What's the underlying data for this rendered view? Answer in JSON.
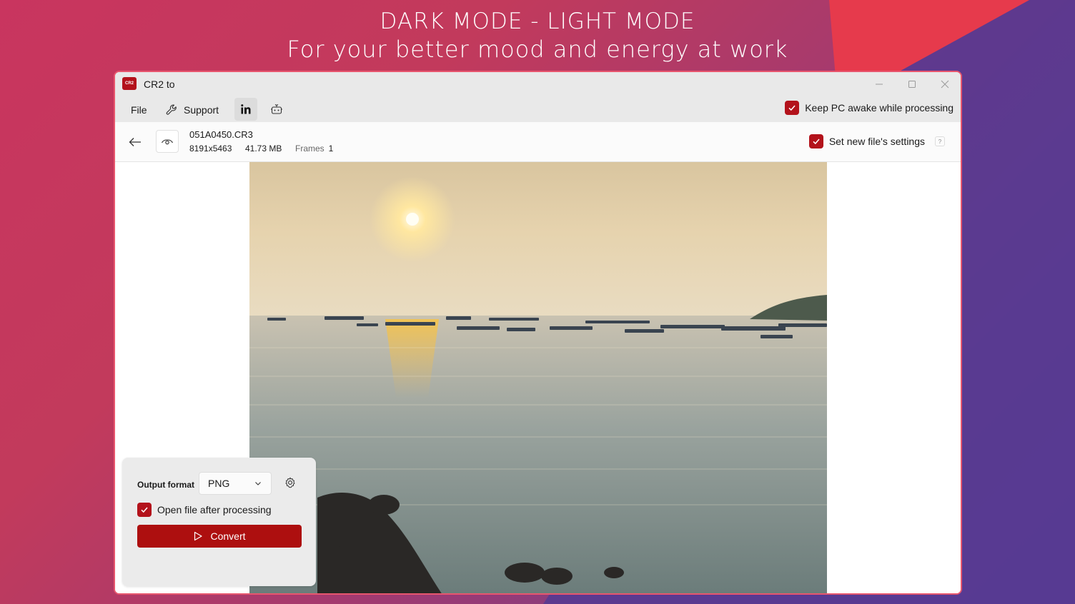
{
  "banner": {
    "line1": "DARK MODE - LIGHT MODE",
    "line2": "For your better mood and energy at work"
  },
  "app": {
    "icon_text": "CR2",
    "title": "CR2 to"
  },
  "window_controls": [
    "minimize-icon",
    "maximize-icon",
    "close-icon"
  ],
  "menu": {
    "file": "File",
    "support": "Support",
    "linkedin_icon": "linkedin-icon",
    "share_icon": "feedback-icon"
  },
  "keep_awake": {
    "label": "Keep PC awake while processing",
    "checked": true
  },
  "file": {
    "name": "051A0450.CR3",
    "dimensions": "8191x5463",
    "size": "41.73 MB",
    "frames_label": "Frames",
    "frames_value": "1"
  },
  "new_settings": {
    "label": "Set new file's settings",
    "checked": true,
    "help": "?"
  },
  "output": {
    "label": "Output format",
    "format": "PNG",
    "open_after_label": "Open file after processing",
    "open_after_checked": true,
    "convert_label": "Convert"
  },
  "colors": {
    "accent": "#b3121b",
    "convert": "#ad0f0f",
    "window_border": "#e8566e"
  }
}
